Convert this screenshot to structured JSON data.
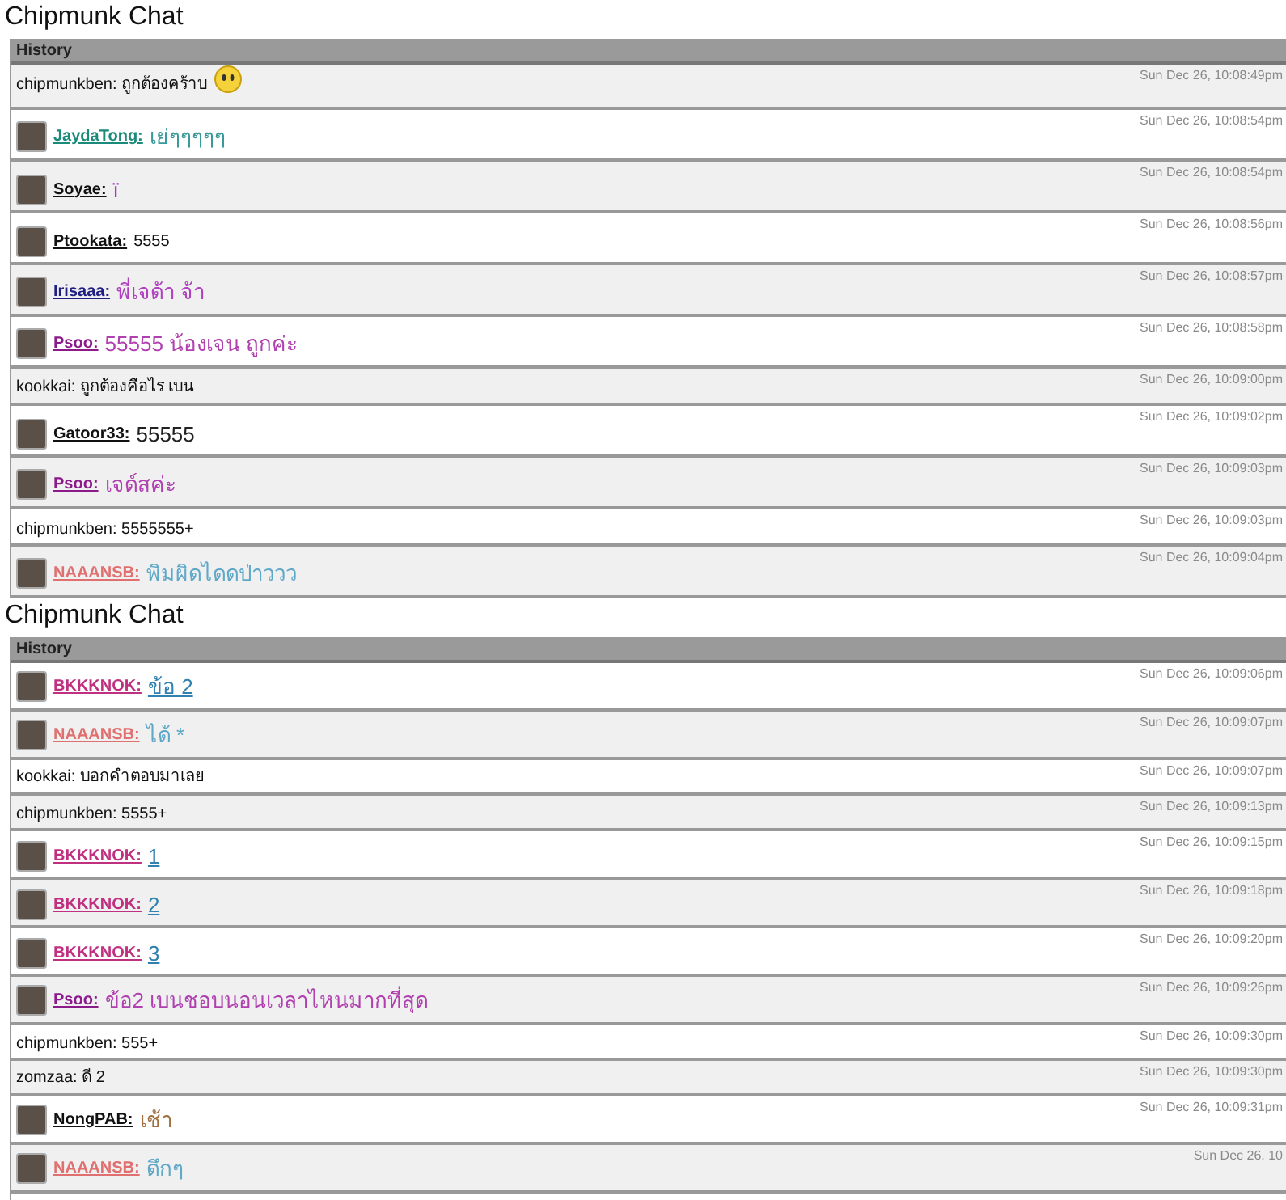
{
  "panels": [
    {
      "title": "Chipmunk Chat",
      "header": "History",
      "rows": [
        {
          "kind": "system",
          "name": {
            "text": "chipmunkben:"
          },
          "message": {
            "text": "ถูกต้องคร้าบ"
          },
          "emoticon": true,
          "time": "Sun Dec 26, 10:08:49pm"
        },
        {
          "kind": "user",
          "name": {
            "text": "JaydaTong:",
            "color": "#1a8a7a"
          },
          "message": {
            "text": "เย่ๆๆๆๆๆ",
            "color": "#3a9a9a"
          },
          "large": true,
          "time": "Sun Dec 26, 10:08:54pm"
        },
        {
          "kind": "user",
          "name": {
            "text": "Soyae:",
            "color": "#111111"
          },
          "message": {
            "text": "ï",
            "color": "#a040c0"
          },
          "large": true,
          "time": "Sun Dec 26, 10:08:54pm"
        },
        {
          "kind": "user",
          "name": {
            "text": "Ptookata:",
            "color": "#111111"
          },
          "message": {
            "text": "5555",
            "color": "#111111"
          },
          "large": false,
          "time": "Sun Dec 26, 10:08:56pm"
        },
        {
          "kind": "user",
          "name": {
            "text": "Irisaaa:",
            "color": "#202080"
          },
          "message": {
            "text": "พี่เจด้า จ้า",
            "color": "#b040c0"
          },
          "large": true,
          "time": "Sun Dec 26, 10:08:57pm"
        },
        {
          "kind": "user",
          "name": {
            "text": "Psoo:",
            "color": "#8b1a8b"
          },
          "message": {
            "text": "55555 น้องเจน ถูกค่ะ",
            "color": "#b040b0"
          },
          "large": true,
          "time": "Sun Dec 26, 10:08:58pm"
        },
        {
          "kind": "system",
          "name": {
            "text": "kookkai:"
          },
          "message": {
            "text": "ถูกต้องคือไร เบน"
          },
          "emoticon": false,
          "time": "Sun Dec 26, 10:09:00pm"
        },
        {
          "kind": "user",
          "name": {
            "text": "Gatoor33:",
            "color": "#111111"
          },
          "message": {
            "text": "55555",
            "color": "#222222"
          },
          "large": true,
          "time": "Sun Dec 26, 10:09:02pm"
        },
        {
          "kind": "user",
          "name": {
            "text": "Psoo:",
            "color": "#8b1a8b"
          },
          "message": {
            "text": "เจด์สค่ะ",
            "color": "#b040b0"
          },
          "large": true,
          "time": "Sun Dec 26, 10:09:03pm"
        },
        {
          "kind": "system",
          "name": {
            "text": "chipmunkben:"
          },
          "message": {
            "text": "5555555+"
          },
          "emoticon": false,
          "time": "Sun Dec 26, 10:09:03pm"
        },
        {
          "kind": "user",
          "name": {
            "text": "NAAANSB:",
            "color": "#e07070"
          },
          "message": {
            "text": "พิมผิดไดดป่าววว",
            "color": "#60a8c8"
          },
          "large": true,
          "time": "Sun Dec 26, 10:09:04pm"
        }
      ]
    },
    {
      "title": "Chipmunk Chat",
      "header": "History",
      "rows": [
        {
          "kind": "user",
          "name": {
            "text": "BKKKNOK:",
            "color": "#c03080"
          },
          "message": {
            "text": "ข้อ 2",
            "color": "#3080b0"
          },
          "large": true,
          "time": "Sun Dec 26, 10:09:06pm"
        },
        {
          "kind": "user",
          "name": {
            "text": "NAAANSB:",
            "color": "#e07070"
          },
          "message": {
            "text": "ได้ *",
            "color": "#60a8c8"
          },
          "large": true,
          "time": "Sun Dec 26, 10:09:07pm"
        },
        {
          "kind": "system",
          "name": {
            "text": "kookkai:"
          },
          "message": {
            "text": "บอกคำตอบมาเลย"
          },
          "emoticon": false,
          "time": "Sun Dec 26, 10:09:07pm"
        },
        {
          "kind": "system",
          "name": {
            "text": "chipmunkben:"
          },
          "message": {
            "text": "5555+"
          },
          "emoticon": false,
          "time": "Sun Dec 26, 10:09:13pm"
        },
        {
          "kind": "user",
          "name": {
            "text": "BKKKNOK:",
            "color": "#c03080"
          },
          "message": {
            "text": "1",
            "color": "#3080b0"
          },
          "large": true,
          "time": "Sun Dec 26, 10:09:15pm"
        },
        {
          "kind": "user",
          "name": {
            "text": "BKKKNOK:",
            "color": "#c03080"
          },
          "message": {
            "text": "2",
            "color": "#3080b0"
          },
          "large": true,
          "time": "Sun Dec 26, 10:09:18pm"
        },
        {
          "kind": "user",
          "name": {
            "text": "BKKKNOK:",
            "color": "#c03080"
          },
          "message": {
            "text": "3",
            "color": "#3080b0"
          },
          "large": true,
          "time": "Sun Dec 26, 10:09:20pm"
        },
        {
          "kind": "user",
          "name": {
            "text": "Psoo:",
            "color": "#8b1a8b"
          },
          "message": {
            "text": "ข้อ2 เบนชอบนอนเวลาไหนมากที่สุด",
            "color": "#b040b0"
          },
          "large": true,
          "time": "Sun Dec 26, 10:09:26pm"
        },
        {
          "kind": "system",
          "name": {
            "text": "chipmunkben:"
          },
          "message": {
            "text": "555+"
          },
          "emoticon": false,
          "time": "Sun Dec 26, 10:09:30pm"
        },
        {
          "kind": "system",
          "name": {
            "text": "zomzaa:"
          },
          "message": {
            "text": "ดี 2"
          },
          "emoticon": false,
          "time": "Sun Dec 26, 10:09:30pm"
        },
        {
          "kind": "user",
          "name": {
            "text": "NongPAB:",
            "color": "#111111"
          },
          "message": {
            "text": "เช้า",
            "color": "#a07040"
          },
          "large": true,
          "time": "Sun Dec 26, 10:09:31pm"
        },
        {
          "kind": "user",
          "name": {
            "text": "NAAANSB:",
            "color": "#e07070"
          },
          "message": {
            "text": "ดึกๆ",
            "color": "#60a8c8"
          },
          "large": true,
          "time": "Sun Dec 26, 10"
        }
      ]
    }
  ]
}
